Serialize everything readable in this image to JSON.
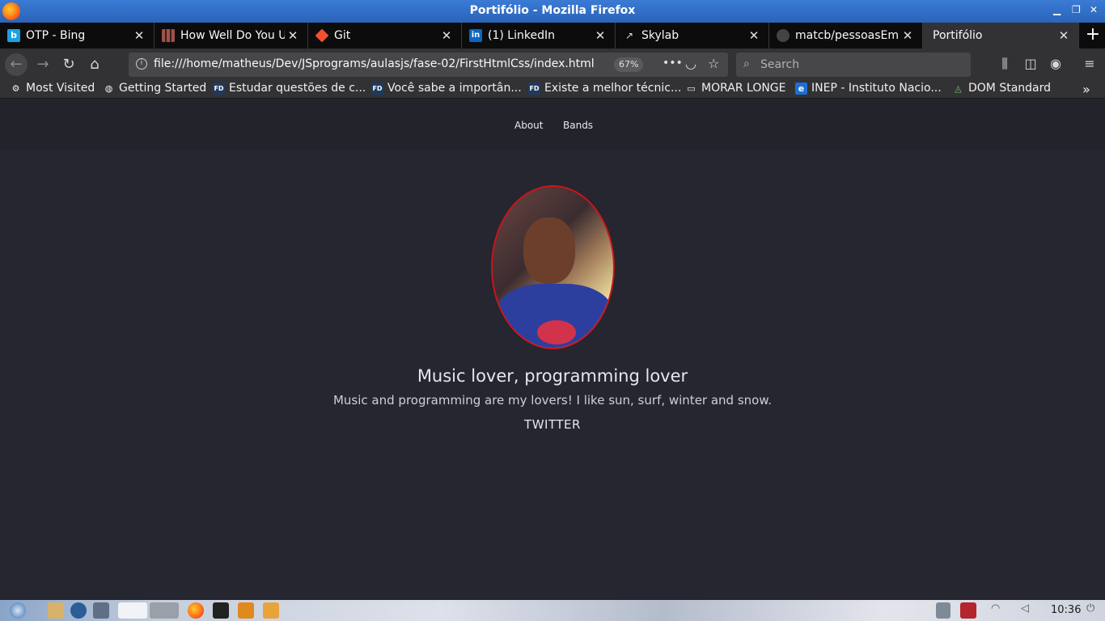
{
  "window": {
    "title": "Portifólio - Mozilla Firefox"
  },
  "tabs": [
    {
      "label": "OTP - Bing",
      "icon": "bing-icon",
      "color": "#1ba1e2"
    },
    {
      "label": "How Well Do You U",
      "icon": "grid-icon",
      "color": "#a0524a"
    },
    {
      "label": "Git",
      "icon": "git-icon",
      "color": "#f14e32"
    },
    {
      "label": "(1) LinkedIn",
      "icon": "linkedin-icon",
      "color": "#0a66c2"
    },
    {
      "label": "Skylab",
      "icon": "skylab-icon",
      "color": "#dddddd"
    },
    {
      "label": "matcb/pessoasEmu",
      "icon": "github-icon",
      "color": "#888888"
    },
    {
      "label": "Portifólio",
      "icon": "",
      "color": ""
    }
  ],
  "navbar": {
    "url": "file:///home/matheus/Dev/JSprograms/aulasjs/fase-02/FirstHtmlCss/index.html",
    "zoom": "67%",
    "search_placeholder": "Search"
  },
  "bookmarks": [
    {
      "label": "Most Visited",
      "icon": "gear-icon"
    },
    {
      "label": "Getting Started",
      "icon": "globe-icon"
    },
    {
      "label": "Estudar questões de c...",
      "icon": "fd-icon"
    },
    {
      "label": "Você sabe a importân...",
      "icon": "fd-icon"
    },
    {
      "label": "Existe a melhor técnic...",
      "icon": "fd-icon"
    },
    {
      "label": "MORAR LONGE",
      "icon": "folder-icon"
    },
    {
      "label": "INEP - Instituto Nacio...",
      "icon": "ie-icon"
    },
    {
      "label": "DOM Standard",
      "icon": "dom-icon"
    }
  ],
  "site": {
    "nav": {
      "about": "About",
      "bands": "Bands"
    },
    "headline": "Music lover, programming lover",
    "bio": "Music and programming are my lovers! I like sun, surf, winter and snow.",
    "twitter": "TWITTER",
    "accent": "#c8151b"
  },
  "taskbar": {
    "clock": "10:36"
  }
}
